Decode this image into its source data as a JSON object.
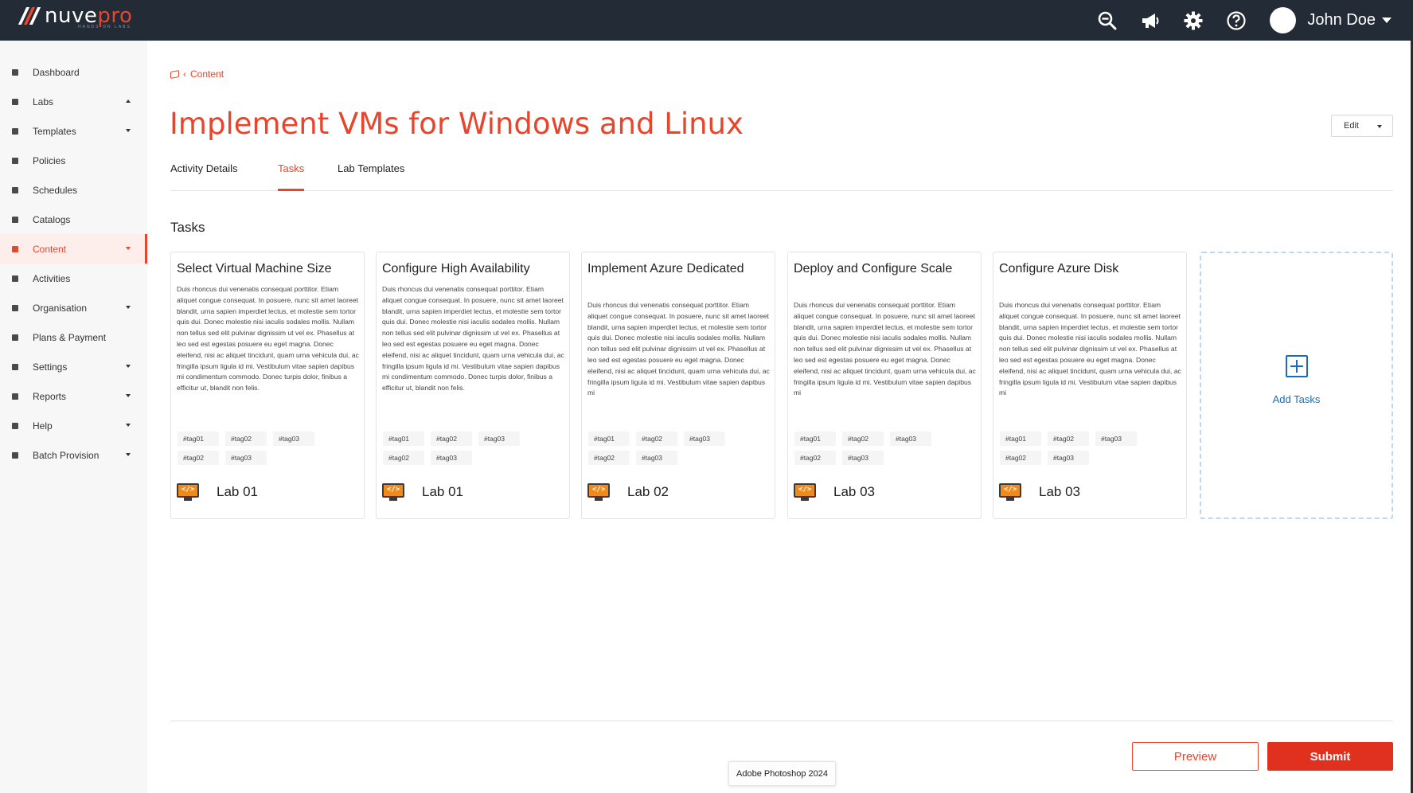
{
  "header": {
    "logo_main": "nuve",
    "logo_accent": "pro",
    "logo_tagline": "HANDS-ON LABS",
    "user_name": "John Doe",
    "icons": [
      "zoom-out-icon",
      "megaphone-icon",
      "gear-icon",
      "help-circle-icon"
    ]
  },
  "sidebar": {
    "items": [
      {
        "label": "Dashboard",
        "icon": "dashboard-icon",
        "caret": "none"
      },
      {
        "label": "Labs",
        "icon": "labs-icon",
        "caret": "up"
      },
      {
        "label": "Templates",
        "icon": "templates-icon",
        "caret": "down"
      },
      {
        "label": "Policies",
        "icon": "policies-icon",
        "caret": "none"
      },
      {
        "label": "Schedules",
        "icon": "schedules-icon",
        "caret": "none"
      },
      {
        "label": "Catalogs",
        "icon": "catalogs-icon",
        "caret": "none"
      },
      {
        "label": "Content",
        "icon": "content-icon",
        "caret": "down",
        "active": true
      },
      {
        "label": "Activities",
        "icon": "activities-icon",
        "caret": "none"
      },
      {
        "label": "Organisation",
        "icon": "organisation-icon",
        "caret": "down"
      },
      {
        "label": "Plans & Payment",
        "icon": "plans-icon",
        "caret": "none"
      },
      {
        "label": "Settings",
        "icon": "settings-icon",
        "caret": "down"
      },
      {
        "label": "Reports",
        "icon": "reports-icon",
        "caret": "down"
      },
      {
        "label": "Help",
        "icon": "help-icon",
        "caret": "down"
      },
      {
        "label": "Batch Provision",
        "icon": "batch-provision-icon",
        "caret": "down"
      }
    ]
  },
  "breadcrumb": {
    "label": "Content"
  },
  "page": {
    "title": "Implement VMs for Windows and Linux",
    "edit_label": "Edit"
  },
  "tabs": [
    {
      "label": "Activity Details",
      "active": false
    },
    {
      "label": "Tasks",
      "active": true
    },
    {
      "label": "Lab Templates",
      "active": false
    }
  ],
  "section_title": "Tasks",
  "cards": [
    {
      "title": "Select Virtual Machine Size",
      "body": "Duis rhoncus dui venenatis consequat porttitor. Etiam aliquet congue consequat. In posuere, nunc sit amet laoreet blandit, urna sapien imperdiet lectus, et molestie sem tortor quis dui. Donec molestie nisi iaculis sodales mollis. Nullam non tellus sed elit pulvinar dignissim ut vel ex. Phasellus at leo sed est egestas posuere eu eget magna. Donec eleifend, nisi ac aliquet tincidunt, quam urna vehicula dui, ac fringilla ipsum ligula id mi. Vestibulum vitae sapien dapibus mi condimentum commodo. Donec turpis dolor, finibus a efficitur ut, blandit non felis.",
      "tags": [
        "#tag01",
        "#tag02",
        "#tag03",
        "#tag02",
        "#tag03"
      ],
      "lab": "Lab 01"
    },
    {
      "title": "Configure High Availability",
      "body": "Duis rhoncus dui venenatis consequat porttitor. Etiam aliquet congue consequat. In posuere, nunc sit amet laoreet blandit, urna sapien imperdiet lectus, et molestie sem tortor quis dui. Donec molestie nisi iaculis sodales mollis. Nullam non tellus sed elit pulvinar dignissim ut vel ex. Phasellus at leo sed est egestas posuere eu eget magna. Donec eleifend, nisi ac aliquet tincidunt, quam urna vehicula dui, ac fringilla ipsum ligula id mi. Vestibulum vitae sapien dapibus mi condimentum commodo. Donec turpis dolor, finibus a efficitur ut, blandit non felis.",
      "tags": [
        "#tag01",
        "#tag02",
        "#tag03",
        "#tag02",
        "#tag03"
      ],
      "lab": "Lab 01"
    },
    {
      "title": "Implement Azure Dedicated",
      "body": "Duis rhoncus dui venenatis consequat porttitor. Etiam aliquet congue consequat. In posuere, nunc sit amet laoreet blandit, urna sapien imperdiet lectus, et molestie sem tortor quis dui. Donec molestie nisi iaculis sodales mollis. Nullam non tellus sed elit pulvinar dignissim ut vel ex. Phasellus at leo sed est egestas posuere eu eget magna. Donec eleifend, nisi ac aliquet tincidunt, quam urna vehicula dui, ac fringilla ipsum ligula id mi. Vestibulum vitae sapien dapibus mi",
      "tags": [
        "#tag01",
        "#tag02",
        "#tag03",
        "#tag02",
        "#tag03"
      ],
      "lab": "Lab 02"
    },
    {
      "title": "Deploy and Configure Scale",
      "body": "Duis rhoncus dui venenatis consequat porttitor. Etiam aliquet congue consequat. In posuere, nunc sit amet laoreet blandit, urna sapien imperdiet lectus, et molestie sem tortor quis dui. Donec molestie nisi iaculis sodales mollis. Nullam non tellus sed elit pulvinar dignissim ut vel ex. Phasellus at leo sed est egestas posuere eu eget magna. Donec eleifend, nisi ac aliquet tincidunt, quam urna vehicula dui, ac fringilla ipsum ligula id mi. Vestibulum vitae sapien dapibus mi",
      "tags": [
        "#tag01",
        "#tag02",
        "#tag03",
        "#tag02",
        "#tag03"
      ],
      "lab": "Lab 03"
    },
    {
      "title": "Configure Azure Disk",
      "body": "Duis rhoncus dui venenatis consequat porttitor. Etiam aliquet congue consequat. In posuere, nunc sit amet laoreet blandit, urna sapien imperdiet lectus, et molestie sem tortor quis dui. Donec molestie nisi iaculis sodales mollis. Nullam non tellus sed elit pulvinar dignissim ut vel ex. Phasellus at leo sed est egestas posuere eu eget magna. Donec eleifend, nisi ac aliquet tincidunt, quam urna vehicula dui, ac fringilla ipsum ligula id mi. Vestibulum vitae sapien dapibus mi",
      "tags": [
        "#tag01",
        "#tag02",
        "#tag03",
        "#tag02",
        "#tag03"
      ],
      "lab": "Lab 03"
    }
  ],
  "add_card": {
    "label": "Add Tasks"
  },
  "footer": {
    "preview_label": "Preview",
    "submit_label": "Submit",
    "tooltip": "Adobe Photoshop 2024"
  },
  "colors": {
    "accent": "#e8452c",
    "topbar": "#232b36",
    "link_blue": "#1c6cb5"
  }
}
